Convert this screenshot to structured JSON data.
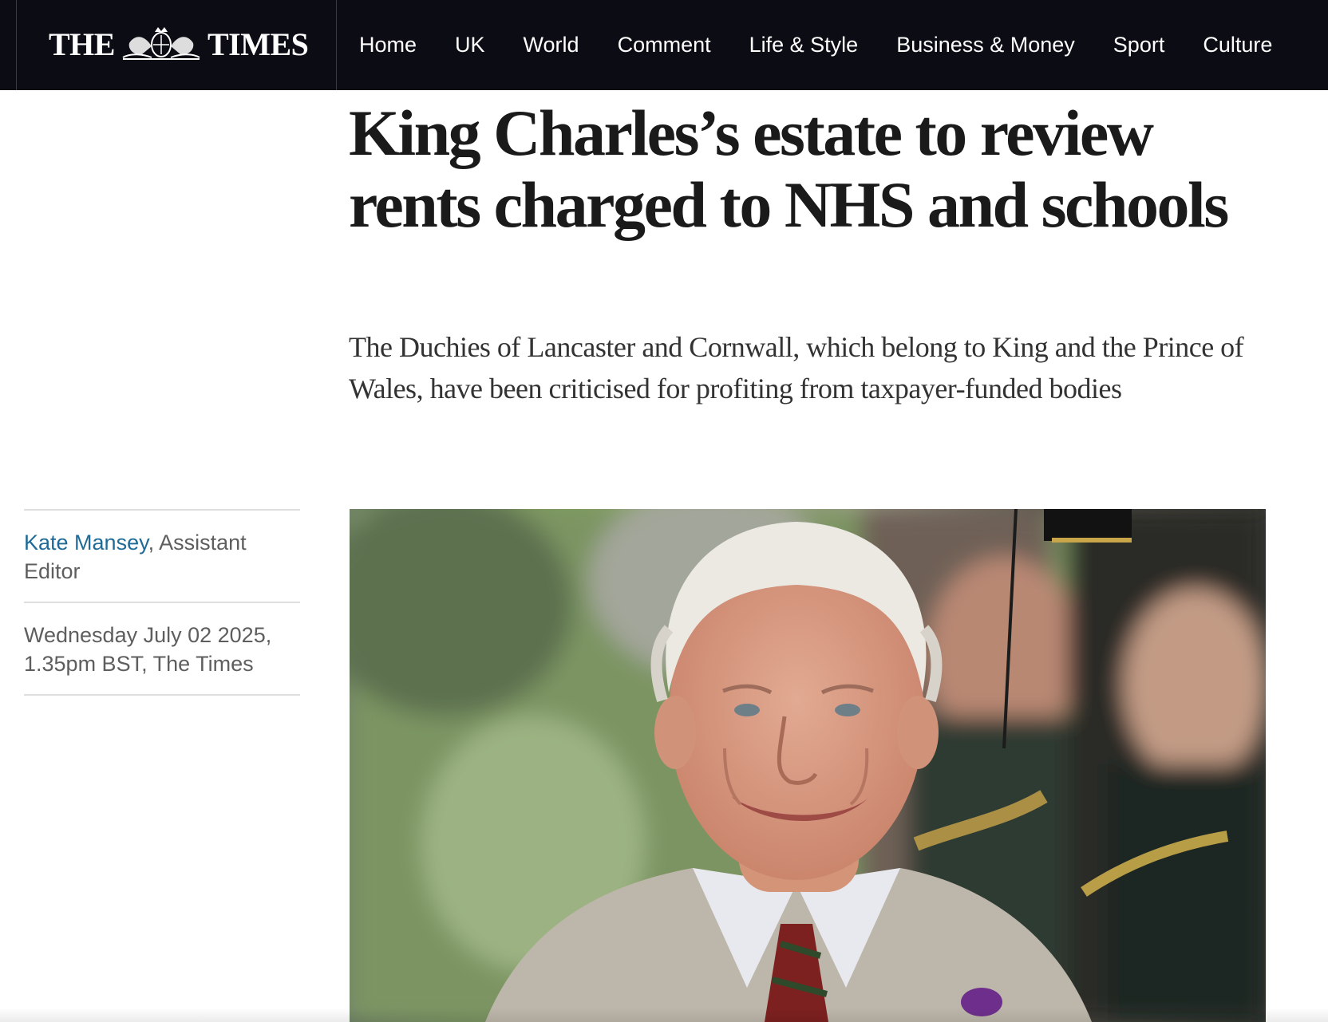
{
  "header": {
    "logo": {
      "left_text": "THE",
      "right_text": "TIMES",
      "crest_icon": "royal-crest-icon"
    },
    "nav": [
      "Home",
      "UK",
      "World",
      "Comment",
      "Life & Style",
      "Business & Money",
      "Sport",
      "Culture"
    ]
  },
  "article": {
    "headline": "King Charles’s estate to review rents charged to NHS and schools",
    "standfirst": "The Duchies of Lancaster and Cornwall, which belong to King and the Prince of Wales, have been criticised for profiting from taxpayer-funded bodies",
    "byline": {
      "author": "Kate Mansey",
      "role": ", Assistant Editor"
    },
    "dateline": "Wednesday July 02 2025, 1.35pm BST, The Times"
  },
  "colors": {
    "topbar_bg": "#0b0c14",
    "author_link": "#1f6a96",
    "headline": "#1a1a1a",
    "meta_text": "#5e5e5e"
  }
}
